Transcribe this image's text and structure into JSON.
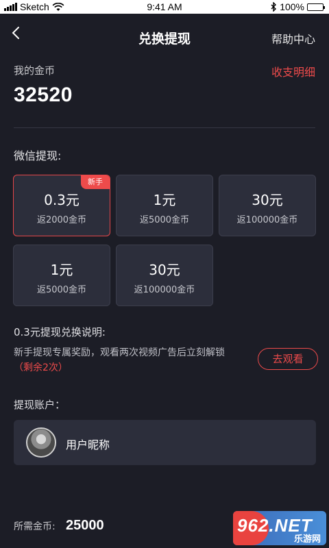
{
  "status_bar": {
    "carrier": "Sketch",
    "time": "9:41 AM",
    "battery": "100%"
  },
  "nav": {
    "back_icon": "chevron-left-icon",
    "title": "兑换提现",
    "help": "帮助中心"
  },
  "coins": {
    "label": "我的金币",
    "value": "32520",
    "detail_link": "收支明细"
  },
  "wechat": {
    "title": "微信提现:",
    "options": [
      {
        "amount": "0.3元",
        "bonus": "返2000金币",
        "badge": "新手",
        "selected": true
      },
      {
        "amount": "1元",
        "bonus": "返5000金币"
      },
      {
        "amount": "30元",
        "bonus": "返100000金币"
      },
      {
        "amount": "1元",
        "bonus": "返5000金币"
      },
      {
        "amount": "30元",
        "bonus": "返100000金币"
      }
    ]
  },
  "description": {
    "title": "0.3元提现兑换说明:",
    "text": "新手提现专属奖励，观看两次视频广告后立刻解锁",
    "remaining": "（剩余2次）",
    "watch_button": "去观看"
  },
  "account": {
    "title": "提现账户：",
    "nickname": "用户昵称"
  },
  "footer": {
    "required_label": "所需金币:",
    "required_value": "25000"
  },
  "watermark": {
    "big": "962.NET",
    "small": "乐游网"
  },
  "colors": {
    "background": "#1c1d26",
    "card": "#2c2e3b",
    "accent": "#ee4b4b"
  }
}
